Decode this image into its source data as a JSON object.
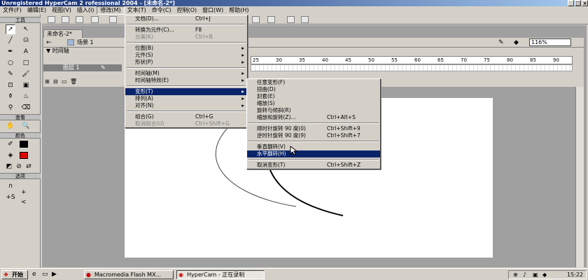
{
  "window": {
    "title": "Unregistered HyperCam 2 rofessional 2004 - [未命名-2*]"
  },
  "menubar": [
    {
      "label": "文件(F)"
    },
    {
      "label": "编辑(E)"
    },
    {
      "label": "视图(V)"
    },
    {
      "label": "插入(I)"
    },
    {
      "label": "修改(M)"
    },
    {
      "label": "文本(T)"
    },
    {
      "label": "命令(C)"
    },
    {
      "label": "控制(O)"
    },
    {
      "label": "窗口(W)"
    },
    {
      "label": "帮助(H)"
    }
  ],
  "tools": {
    "header": "工具",
    "view_header": "查看",
    "colors_header": "颜色",
    "options_header": "选项"
  },
  "document": {
    "tab": "未命名-2*",
    "scene": "场景 1",
    "timeline_label": "时间轴",
    "layer": "图层 1",
    "zoom": "116%",
    "ruler_ticks": [
      "25",
      "30",
      "35",
      "40",
      "45",
      "50",
      "55",
      "60",
      "65",
      "70",
      "75",
      "80",
      "85",
      "90"
    ]
  },
  "modify_menu": [
    {
      "label": "文档(D)...",
      "shortcut": "Ctrl+J"
    },
    {
      "sep": true
    },
    {
      "label": "转换为元件(C)...",
      "shortcut": "F8"
    },
    {
      "label": "分离(K)",
      "shortcut": "Ctrl+B",
      "disabled": true
    },
    {
      "sep": true
    },
    {
      "label": "位图(B)",
      "submenu": true
    },
    {
      "label": "元件(S)",
      "submenu": true
    },
    {
      "label": "形状(P)",
      "submenu": true
    },
    {
      "sep": true
    },
    {
      "label": "时间轴(M)",
      "submenu": true
    },
    {
      "label": "时间轴特效(E)",
      "submenu": true
    },
    {
      "sep": true
    },
    {
      "label": "变形(T)",
      "submenu": true,
      "highlighted": true
    },
    {
      "label": "排列(A)",
      "submenu": true
    },
    {
      "label": "对齐(N)",
      "submenu": true
    },
    {
      "sep": true
    },
    {
      "label": "组合(G)",
      "shortcut": "Ctrl+G"
    },
    {
      "label": "取消组合(U)",
      "shortcut": "Ctrl+Shift+G",
      "disabled": true
    }
  ],
  "transform_menu": [
    {
      "label": "任意变形(F)"
    },
    {
      "label": "扭曲(D)"
    },
    {
      "label": "封套(E)"
    },
    {
      "label": "缩放(S)"
    },
    {
      "label": "旋转与倾斜(R)"
    },
    {
      "label": "缩放和旋转(Z)...",
      "shortcut": "Ctrl+Alt+S"
    },
    {
      "sep": true
    },
    {
      "label": "顺时针旋转 90 度(0)",
      "shortcut": "Ctrl+Shift+9"
    },
    {
      "label": "逆时针旋转 90 度(9)",
      "shortcut": "Ctrl+Shift+7"
    },
    {
      "sep": true
    },
    {
      "label": "垂直翻转(V)"
    },
    {
      "label": "水平翻转(H)",
      "highlighted": true
    },
    {
      "sep": true
    },
    {
      "label": "取消变形(T)",
      "shortcut": "Ctrl+Shift+Z"
    }
  ],
  "taskbar": {
    "start": "开始",
    "tasks": [
      {
        "label": "Macromedia Flash MX..."
      },
      {
        "label": "HyperCam - 正在录制",
        "active": true
      }
    ],
    "clock": "15:22"
  }
}
